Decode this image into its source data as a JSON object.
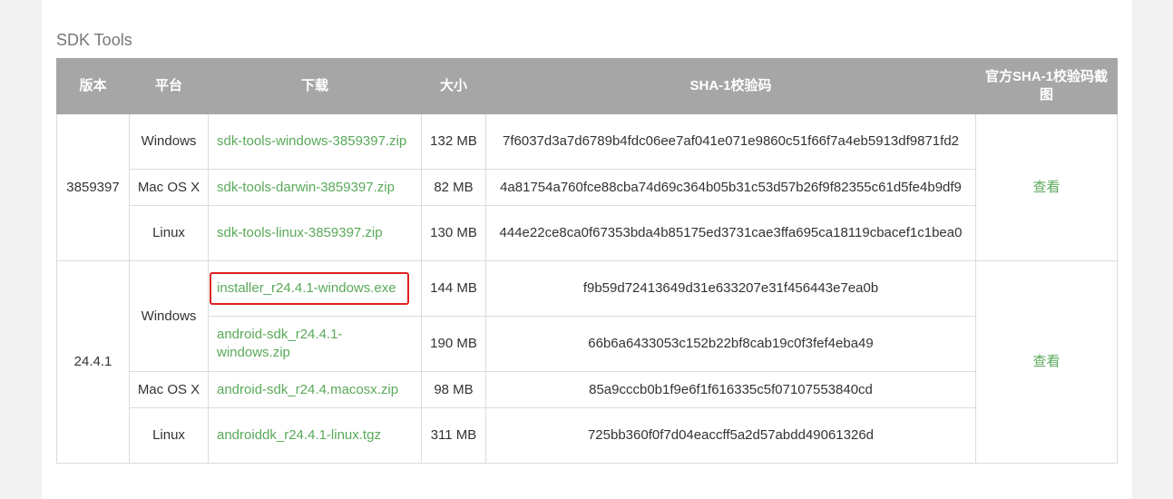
{
  "section_title": "SDK Tools",
  "headers": {
    "version": "版本",
    "platform": "平台",
    "download": "下载",
    "size": "大小",
    "sha1": "SHA-1校验码",
    "screenshot": "官方SHA-1校验码截图"
  },
  "groups": [
    {
      "version": "3859397",
      "view_label": "查看",
      "rows": [
        {
          "platform": "Windows",
          "file": "sdk-tools-windows-3859397.zip",
          "size": "132 MB",
          "sha1": "7f6037d3a7d6789b4fdc06ee7af041e071e9860c51f66f7a4eb5913df9871fd2"
        },
        {
          "platform": "Mac OS X",
          "file": "sdk-tools-darwin-3859397.zip",
          "size": "82 MB",
          "sha1": "4a81754a760fce88cba74d69c364b05b31c53d57b26f9f82355c61d5fe4b9df9"
        },
        {
          "platform": "Linux",
          "file": "sdk-tools-linux-3859397.zip",
          "size": "130 MB",
          "sha1": "444e22ce8ca0f67353bda4b85175ed3731cae3ffa695ca18119cbacef1c1bea0"
        }
      ]
    },
    {
      "version": "24.4.1",
      "view_label": "查看",
      "platform_windows": "Windows",
      "rows": [
        {
          "file": "installer_r24.4.1-windows.exe",
          "size": "144 MB",
          "sha1": "f9b59d72413649d31e633207e31f456443e7ea0b"
        },
        {
          "file": "android-sdk_r24.4.1-windows.zip",
          "size": "190 MB",
          "sha1": "66b6a6433053c152b22bf8cab19c0f3fef4eba49"
        },
        {
          "platform": "Mac OS X",
          "file": "android-sdk_r24.4.macosx.zip",
          "size": "98 MB",
          "sha1": "85a9cccb0b1f9e6f1f616335c5f07107553840cd"
        },
        {
          "platform": "Linux",
          "file": "androiddk_r24.4.1-linux.tgz",
          "size": "311 MB",
          "sha1": "725bb360f0f7d04eaccff5a2d57abdd49061326d"
        }
      ]
    }
  ],
  "highlight_color": "#e02020",
  "link_color": "#5aa95a",
  "header_bg": "#a6a6a6"
}
